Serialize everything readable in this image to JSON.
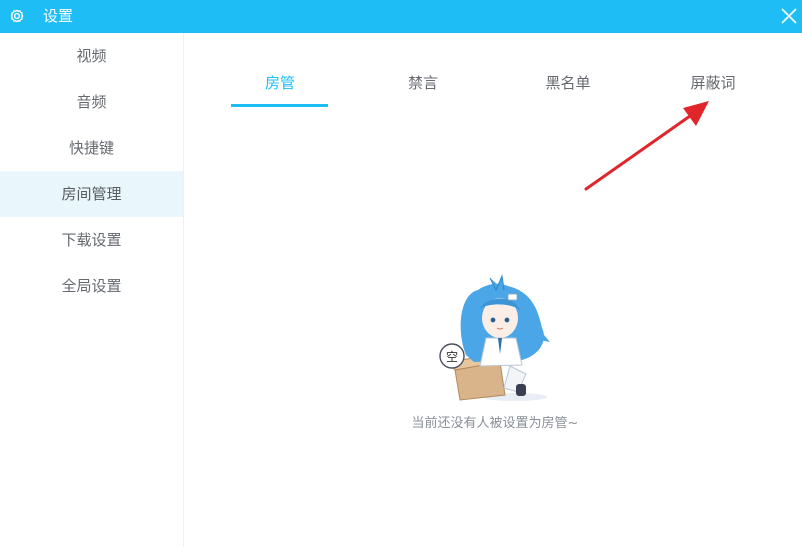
{
  "window": {
    "title": "设置"
  },
  "sidebar": {
    "items": [
      {
        "label": "视频"
      },
      {
        "label": "音频"
      },
      {
        "label": "快捷键"
      },
      {
        "label": "房间管理",
        "active": true
      },
      {
        "label": "下载设置"
      },
      {
        "label": "全局设置"
      }
    ]
  },
  "tabs": [
    {
      "label": "房管",
      "active": true
    },
    {
      "label": "禁言"
    },
    {
      "label": "黑名单"
    },
    {
      "label": "屏蔽词"
    }
  ],
  "empty_state": {
    "bubble_text": "空",
    "message": "当前还没有人被设置为房管~"
  },
  "colors": {
    "accent": "#1ebdf5",
    "annotation_arrow": "#e0262b"
  },
  "icons": {
    "window": "gear-icon",
    "close": "close-icon"
  }
}
